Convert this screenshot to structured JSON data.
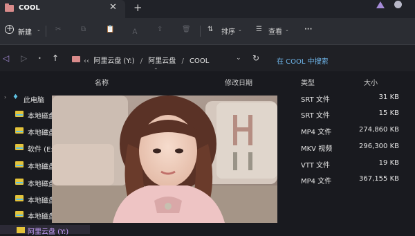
{
  "tab": {
    "title": "COOL",
    "close_icon": "close-icon",
    "new_tab_icon": "plus-icon"
  },
  "toolbar": {
    "new_label": "新建",
    "sort_label": "排序",
    "view_label": "查看",
    "more_label": "···"
  },
  "address": {
    "crumbs": [
      "阿里云盘 (Y:)",
      "阿里云盘",
      "COOL"
    ],
    "prefix": "‹‹",
    "search_placeholder": "在 COOL 中搜索"
  },
  "columns": {
    "name": "名称",
    "modified": "修改日期",
    "type": "类型",
    "size": "大小"
  },
  "sidebar": {
    "pc_label": "此电脑",
    "items": [
      {
        "label": "本地磁盘"
      },
      {
        "label": "本地磁盘"
      },
      {
        "label": "软件 (E:)"
      },
      {
        "label": "本地磁盘"
      },
      {
        "label": "本地磁盘"
      },
      {
        "label": "本地磁盘"
      },
      {
        "label": "本地磁盘"
      }
    ],
    "selected_label": "阿里云盘 (Y:)"
  },
  "files": [
    {
      "type": "SRT 文件",
      "size": "31 KB"
    },
    {
      "type": "SRT 文件",
      "size": "15 KB"
    },
    {
      "type": "MP4 文件",
      "size": "274,860 KB"
    },
    {
      "type": "MKV 视频",
      "size": "296,300 KB"
    },
    {
      "type": "VTT 文件",
      "size": "19 KB"
    },
    {
      "type": "MP4 文件",
      "size": "367,155 KB"
    }
  ],
  "colors": {
    "accent": "#70b8ee",
    "folder": "#d98b8b",
    "drive": "#e4c33a"
  }
}
